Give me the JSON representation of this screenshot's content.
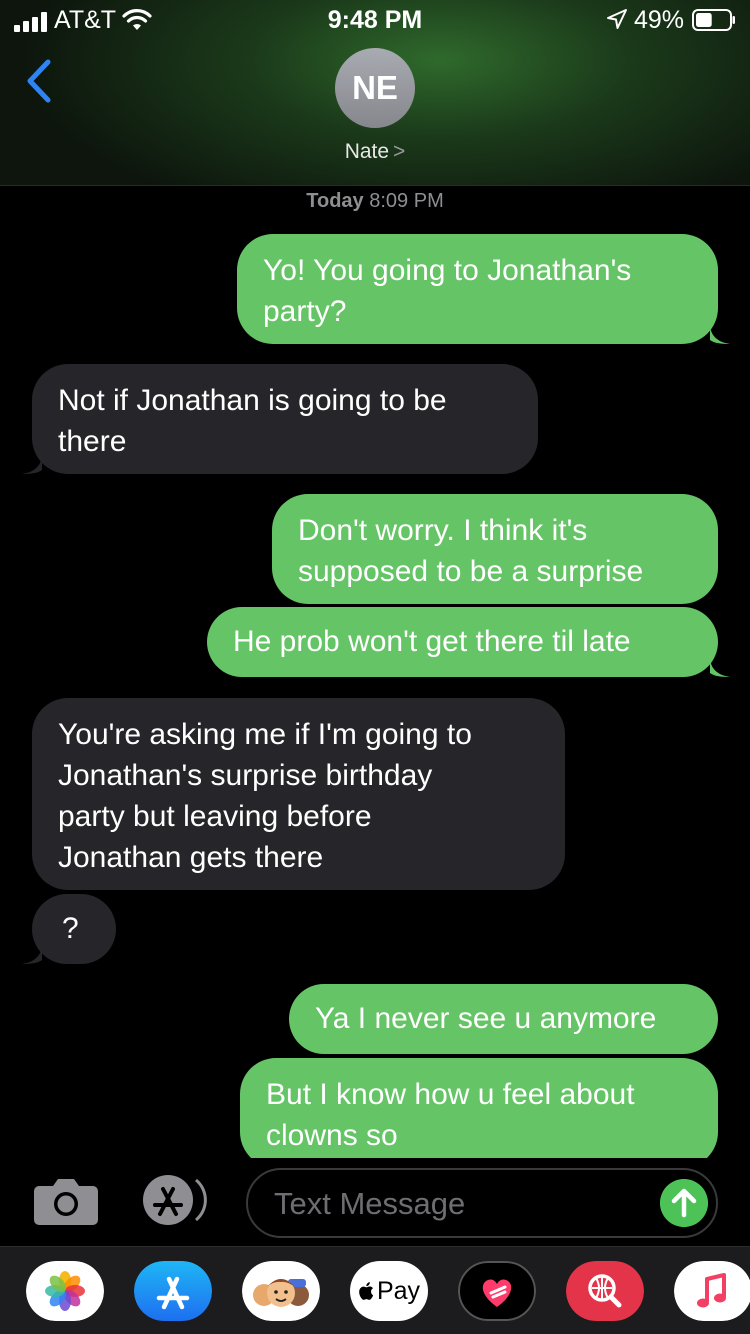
{
  "status_bar": {
    "carrier": "AT&T",
    "time": "9:48 PM",
    "battery_percent": "49%",
    "battery_level": 0.49
  },
  "header": {
    "avatar_initials": "NE",
    "contact_name": "Nate",
    "chevron": ">"
  },
  "conversation": {
    "timestamp_day": "Today",
    "timestamp_time": "8:09 PM",
    "messages": [
      {
        "from": "me",
        "text": "Yo! You going to Jonathan's\nparty?"
      },
      {
        "from": "them",
        "text": "Not if Jonathan is going to be\nthere"
      },
      {
        "from": "me",
        "text": "Don't worry. I think it's\nsupposed to be a surprise"
      },
      {
        "from": "me",
        "text": "He prob won't get there til late"
      },
      {
        "from": "them",
        "text": "You're asking me if I'm going to\nJonathan's surprise birthday\nparty but leaving before\nJonathan gets there"
      },
      {
        "from": "them",
        "text": "?"
      },
      {
        "from": "me",
        "text": "Ya I never see u anymore"
      },
      {
        "from": "me",
        "text": "But I know how u feel about\nclowns so"
      }
    ]
  },
  "composer": {
    "placeholder": "Text Message"
  },
  "drawer": {
    "apple_pay_label": "Pay"
  },
  "colors": {
    "sent_bubble": "#65c466",
    "received_bubble": "#26262a",
    "accent_blue": "#2f84f5"
  }
}
